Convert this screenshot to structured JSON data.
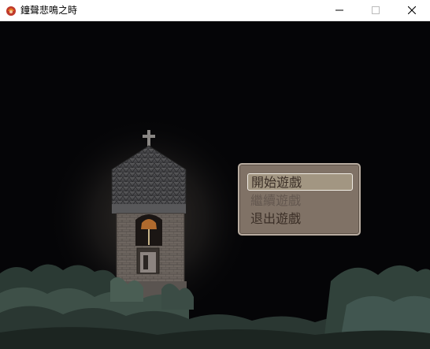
{
  "window": {
    "title": "鐘聲悲鳴之時",
    "controls": {
      "minimize": "minimize",
      "maximize": "maximize",
      "close": "close"
    }
  },
  "scene": {
    "description_icons": [
      "church-tower",
      "cross",
      "bell",
      "forest"
    ]
  },
  "title_menu": {
    "items": [
      {
        "label": "開始遊戲",
        "state": "selected"
      },
      {
        "label": "繼續遊戲",
        "state": "disabled"
      },
      {
        "label": "退出遊戲",
        "state": "normal"
      }
    ]
  },
  "colors": {
    "menu_bg": "#807266",
    "menu_border": "#b8aca0",
    "menu_text": "#3a2e26",
    "sky": "#050507"
  }
}
